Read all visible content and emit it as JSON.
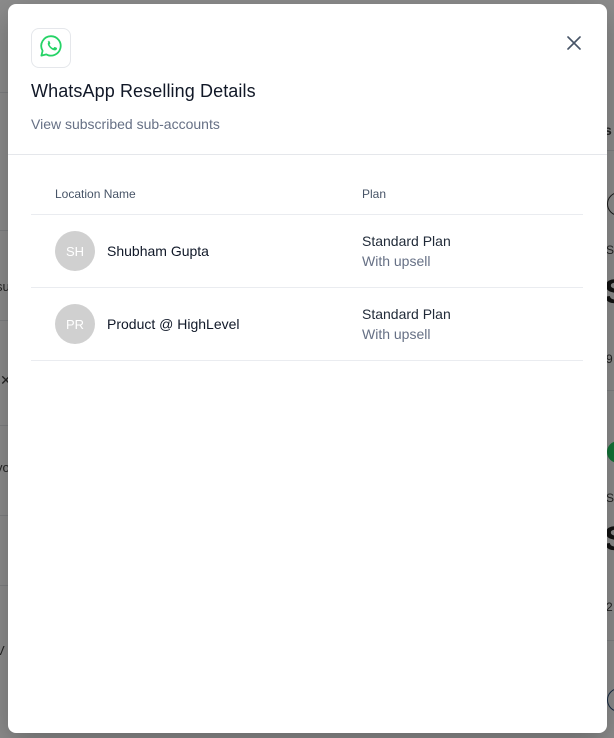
{
  "background": {
    "fragments": [
      {
        "text": "s"
      },
      {
        "text": "S"
      },
      {
        "text": "S"
      },
      {
        "text": "9"
      },
      {
        "text": "S"
      },
      {
        "text": "S"
      },
      {
        "text": "2"
      },
      {
        "text": "su"
      },
      {
        "text": "vo"
      },
      {
        "text": "V"
      }
    ]
  },
  "modal": {
    "icon": "whatsapp-icon",
    "title": "WhatsApp Reselling Details",
    "subtitle": "View subscribed sub-accounts",
    "close_icon": "close-icon"
  },
  "table": {
    "columns": [
      "Location Name",
      "Plan"
    ],
    "rows": [
      {
        "initials": "SH",
        "name": "Shubham Gupta",
        "plan": "Standard Plan",
        "plan_detail": "With upsell"
      },
      {
        "initials": "PR",
        "name": "Product @ HighLevel",
        "plan": "Standard Plan",
        "plan_detail": "With upsell"
      }
    ]
  },
  "colors": {
    "whatsapp_green": "#25D366",
    "avatar_bg": "#D0D0D0",
    "overlay": "rgba(0,0,0,0.45)"
  }
}
